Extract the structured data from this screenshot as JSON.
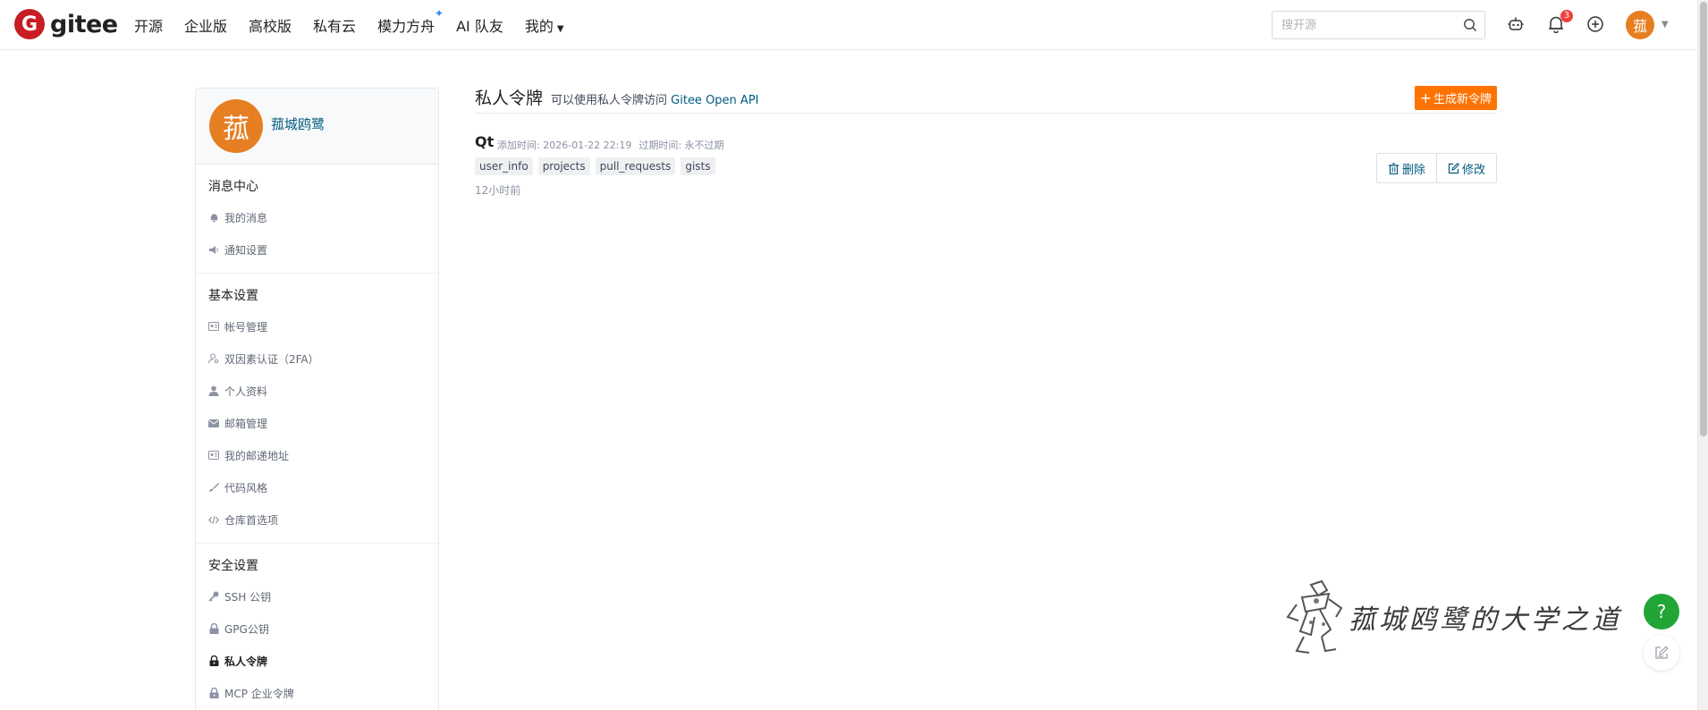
{
  "brand": {
    "mark": "G",
    "name": "gitee"
  },
  "nav": [
    {
      "label": "开源"
    },
    {
      "label": "企业版"
    },
    {
      "label": "高校版"
    },
    {
      "label": "私有云"
    },
    {
      "label": "模力方舟"
    },
    {
      "label": "AI 队友"
    },
    {
      "label": "我的"
    }
  ],
  "search": {
    "placeholder": "搜开源"
  },
  "header": {
    "notification_count": "3",
    "avatar_char": "菰"
  },
  "sidebar": {
    "avatar_char": "菰",
    "user_name": "菰城鸥鹭",
    "groups": [
      {
        "title": "消息中心",
        "items": [
          {
            "label": "我的消息"
          },
          {
            "label": "通知设置"
          }
        ]
      },
      {
        "title": "基本设置",
        "items": [
          {
            "label": "帐号管理"
          },
          {
            "label": "双因素认证（2FA）"
          },
          {
            "label": "个人资料"
          },
          {
            "label": "邮箱管理"
          },
          {
            "label": "我的邮递地址"
          },
          {
            "label": "代码风格"
          },
          {
            "label": "仓库首选项"
          }
        ]
      },
      {
        "title": "安全设置",
        "items": [
          {
            "label": "SSH 公钥"
          },
          {
            "label": "GPG公钥"
          },
          {
            "label": "私人令牌"
          },
          {
            "label": "MCP 企业令牌"
          }
        ]
      }
    ]
  },
  "main": {
    "title": "私人令牌",
    "subtitle": "可以使用私人令牌访问",
    "api_link": "Gitee Open API",
    "generate_button": "生成新令牌"
  },
  "token": {
    "name": "Qt",
    "added_label": "添加时间: 2026-01-22 22:19",
    "expire_label": "过期时间: 永不过期",
    "scopes": [
      "user_info",
      "projects",
      "pull_requests",
      "gists"
    ],
    "relative_time": "12小时前",
    "delete_label": "删除",
    "edit_label": "修改"
  },
  "floating": {
    "help": "?"
  },
  "watermark": {
    "text": "菰城鸥鹭的大学之道"
  },
  "colors": {
    "brand_red": "#c71d23",
    "accent_orange": "#fe7300",
    "link_blue": "#005980",
    "help_green": "#21a537",
    "avatar_orange": "#e67e22"
  }
}
